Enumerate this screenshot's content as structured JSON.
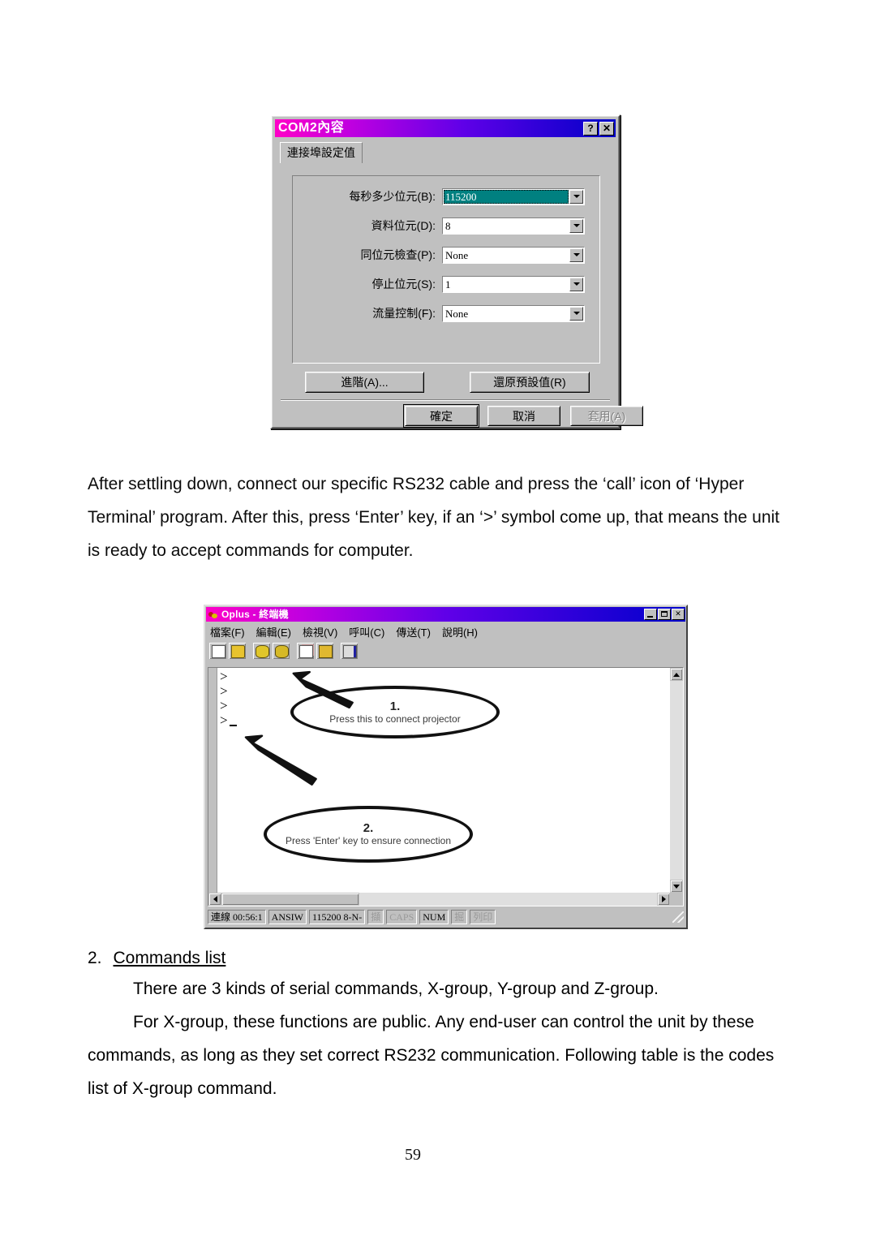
{
  "dialog": {
    "title": "COM2內容",
    "help_button": "?",
    "close_button": "✕",
    "tab_label": "連接埠設定值",
    "fields": [
      {
        "label": "每秒多少位元(B):",
        "value": "115200",
        "selected": true
      },
      {
        "label": "資料位元(D):",
        "value": "8",
        "selected": false
      },
      {
        "label": "同位元檢查(P):",
        "value": "None",
        "selected": false
      },
      {
        "label": "停止位元(S):",
        "value": "1",
        "selected": false
      },
      {
        "label": "流量控制(F):",
        "value": "None",
        "selected": false
      }
    ],
    "advanced_button": "進階(A)...",
    "restore_button": "還原預設值(R)",
    "ok_button": "確定",
    "cancel_button": "取消",
    "apply_button": "套用(A)",
    "accent_title_start": "#ff00c8",
    "accent_title_end": "#0000c8",
    "selection_color": "#008080"
  },
  "paragraph_top": {
    "line1": "After settling down, connect our specific RS232 cable and press the ‘call’ icon of ‘Hyper",
    "line2": "Terminal’ program. After this, press ‘Enter’ key, if an ‘>’ symbol come up, that means the unit",
    "line3": "is ready to accept commands for computer."
  },
  "terminal": {
    "title": "Oplus - 終端機",
    "minimize_button": "_",
    "maximize_button": "□",
    "close_button": "✕",
    "menu": [
      "檔案(F)",
      "編輯(E)",
      "檢視(V)",
      "呼叫(C)",
      "傳送(T)",
      "說明(H)"
    ],
    "toolbar_icons": [
      "new-connection-icon",
      "open-file-icon",
      "call-icon",
      "disconnect-icon",
      "copy-icon",
      "paste-icon",
      "properties-icon"
    ],
    "screen_lines": [
      ">",
      ">",
      ">",
      ">"
    ],
    "annotations": [
      {
        "number": "1.",
        "text": "Press this to connect projector"
      },
      {
        "number": "2.",
        "text": "Press 'Enter' key to ensure connection"
      }
    ],
    "status": {
      "connected": "連線 00:56:1",
      "emulation": "ANSIW",
      "line_settings": "115200 8-N-",
      "capture": "擷",
      "caps": "CAPS",
      "num": "NUM",
      "scroll": "掘",
      "print": "列印"
    }
  },
  "section": {
    "number": "2.",
    "heading": "Commands list",
    "line1": "There are 3 kinds of serial commands, X-group, Y-group and Z-group.",
    "line2": "For X-group, these functions are public. Any end-user can control the unit by these",
    "line3": "commands, as long as they set correct RS232 communication. Following table is the codes",
    "line4": "list of X-group command."
  },
  "page_number": "59"
}
